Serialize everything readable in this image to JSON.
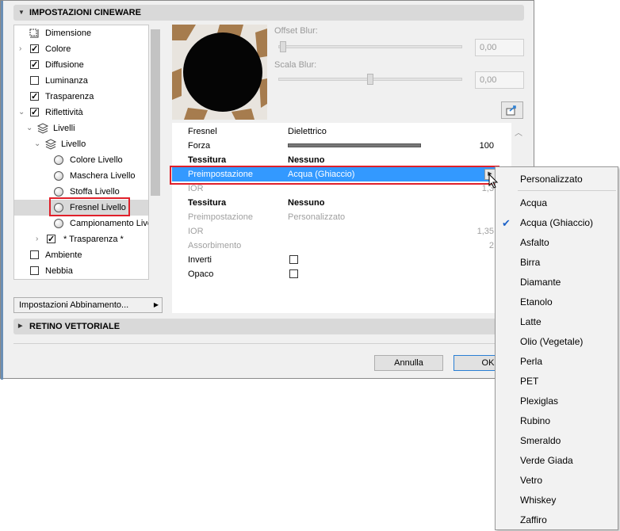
{
  "dialog": {
    "section_title": "IMPOSTAZIONI CINEWARE",
    "section2_title": "RETINO VETTORIALE",
    "match_settings_label": "Impostazioni Abbinamento...",
    "cancel_label": "Annulla",
    "ok_label": "OK"
  },
  "tree": {
    "items": [
      {
        "label": "Dimensione",
        "control": "dimension-icon"
      },
      {
        "label": "Colore",
        "control": "checkbox",
        "checked": true
      },
      {
        "label": "Diffusione",
        "control": "checkbox",
        "checked": true
      },
      {
        "label": "Luminanza",
        "control": "checkbox",
        "checked": false
      },
      {
        "label": "Trasparenza",
        "control": "checkbox",
        "checked": true
      },
      {
        "label": "Riflettività",
        "control": "checkbox",
        "checked": true
      },
      {
        "label": "Livelli",
        "control": "layers-icon"
      },
      {
        "label": "Livello",
        "control": "layers-icon"
      },
      {
        "label": "Colore Livello",
        "control": "radio"
      },
      {
        "label": "Maschera Livello",
        "control": "radio"
      },
      {
        "label": "Stoffa Livello",
        "control": "radio"
      },
      {
        "label": "Fresnel Livello",
        "control": "radio",
        "selected": true
      },
      {
        "label": "Campionamento Livello",
        "control": "radio"
      },
      {
        "label": "* Trasparenza *",
        "control": "checkbox",
        "checked": true
      },
      {
        "label": "Ambiente",
        "control": "checkbox",
        "checked": false
      },
      {
        "label": "Nebbia",
        "control": "checkbox",
        "checked": false
      }
    ]
  },
  "blur": {
    "offset_label": "Offset Blur:",
    "offset_value": "0,00",
    "scale_label": "Scala Blur:",
    "scale_value": "0,00"
  },
  "properties": {
    "rows": [
      {
        "key": "Fresnel",
        "value": "Dielettrico",
        "num": ""
      },
      {
        "key": "Forza",
        "value": "",
        "num": "100",
        "slider_fraction": 1.0
      },
      {
        "key": "Tessitura",
        "value": "Nessuno",
        "num": ""
      },
      {
        "key": "Preimpostazione",
        "value": "Acqua (Ghiaccio)",
        "num": ""
      },
      {
        "key": "IOR",
        "value": "",
        "num": "1,3"
      },
      {
        "key": "Tessitura",
        "value": "Nessuno",
        "num": ""
      },
      {
        "key": "Preimpostazione",
        "value": "Personalizzato",
        "num": ""
      },
      {
        "key": "IOR",
        "value": "",
        "num": "1,35"
      },
      {
        "key": "Assorbimento",
        "value": "",
        "num": "2"
      },
      {
        "key": "Inverti",
        "value": "",
        "num": ""
      },
      {
        "key": "Opaco",
        "value": "",
        "num": ""
      }
    ]
  },
  "preset_menu": {
    "items": [
      {
        "label": "Personalizzato"
      },
      {
        "label": "Acqua"
      },
      {
        "label": "Acqua (Ghiaccio)",
        "checked": true
      },
      {
        "label": "Asfalto"
      },
      {
        "label": "Birra"
      },
      {
        "label": "Diamante"
      },
      {
        "label": "Etanolo"
      },
      {
        "label": "Latte"
      },
      {
        "label": "Olio (Vegetale)"
      },
      {
        "label": "Perla"
      },
      {
        "label": "PET"
      },
      {
        "label": "Plexiglas"
      },
      {
        "label": "Rubino"
      },
      {
        "label": "Smeraldo"
      },
      {
        "label": "Verde Giada"
      },
      {
        "label": "Vetro"
      },
      {
        "label": "Whiskey"
      },
      {
        "label": "Zaffiro"
      }
    ]
  },
  "colors": {
    "selection": "#3399ff",
    "highlight_border": "#e0202a",
    "check_accent": "#1e63c8"
  }
}
